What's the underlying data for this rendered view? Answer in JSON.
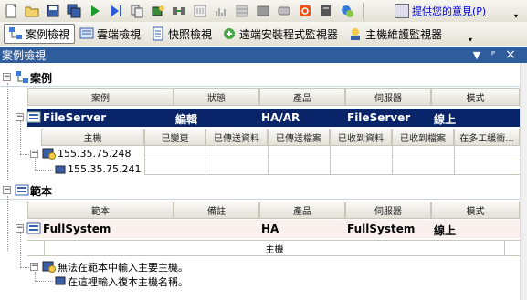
{
  "toolbar": {
    "icons": [
      "new-icon",
      "open-icon",
      "save-icon",
      "save-all-icon",
      "run-icon",
      "step-icon",
      "copy-host-icon",
      "host-config-icon",
      "sync-icon",
      "switch-icon",
      "chart-icon",
      "grid-icon",
      "disk-icon",
      "tape-icon",
      "stop-icon",
      "node-icon",
      "chat-icon"
    ],
    "feedback_label": "提供您的意見(P)"
  },
  "view_tabs": [
    {
      "label": "案例檢視",
      "icon": "scenario-view-icon",
      "active": true
    },
    {
      "label": "雲端檢視",
      "icon": "cloud-view-icon",
      "active": false
    },
    {
      "label": "快照檢視",
      "icon": "snapshot-view-icon",
      "active": false
    },
    {
      "label": "遠端安裝程式監視器",
      "icon": "remote-installer-icon",
      "active": false
    },
    {
      "label": "主機維護監視器",
      "icon": "host-maintenance-icon",
      "active": false
    }
  ],
  "panel": {
    "title": "案例檢視",
    "buttons": {
      "dropdown": "▼",
      "pin": "ᴾ",
      "close": "×"
    }
  },
  "scenarios_group": {
    "label": "案例",
    "columns": [
      "案例",
      "狀態",
      "產品",
      "伺服器",
      "模式"
    ],
    "scenario": {
      "name": "FileServer",
      "status": "編輯",
      "product": "HA/AR",
      "server": "FileServer",
      "mode": "線上"
    },
    "host_columns": [
      "主機",
      "已變更",
      "已傳送資料",
      "已傳送檔案",
      "已收到資料",
      "已收到檔案",
      "在多工緩衝..."
    ],
    "hosts": [
      {
        "name": "155.35.75.248"
      },
      {
        "name": "155.35.75.241"
      }
    ]
  },
  "templates_group": {
    "label": "範本",
    "columns": [
      "範本",
      "備註",
      "產品",
      "伺服器",
      "模式"
    ],
    "template": {
      "name": "FullSystem",
      "remark": "",
      "product": "HA",
      "server": "FullSystem",
      "mode": "線上"
    },
    "host_column": "主機",
    "hosts": [
      {
        "name": "無法在範本中輸入主要主機。"
      },
      {
        "name": "在這裡輸入複本主機名稱。"
      }
    ]
  }
}
